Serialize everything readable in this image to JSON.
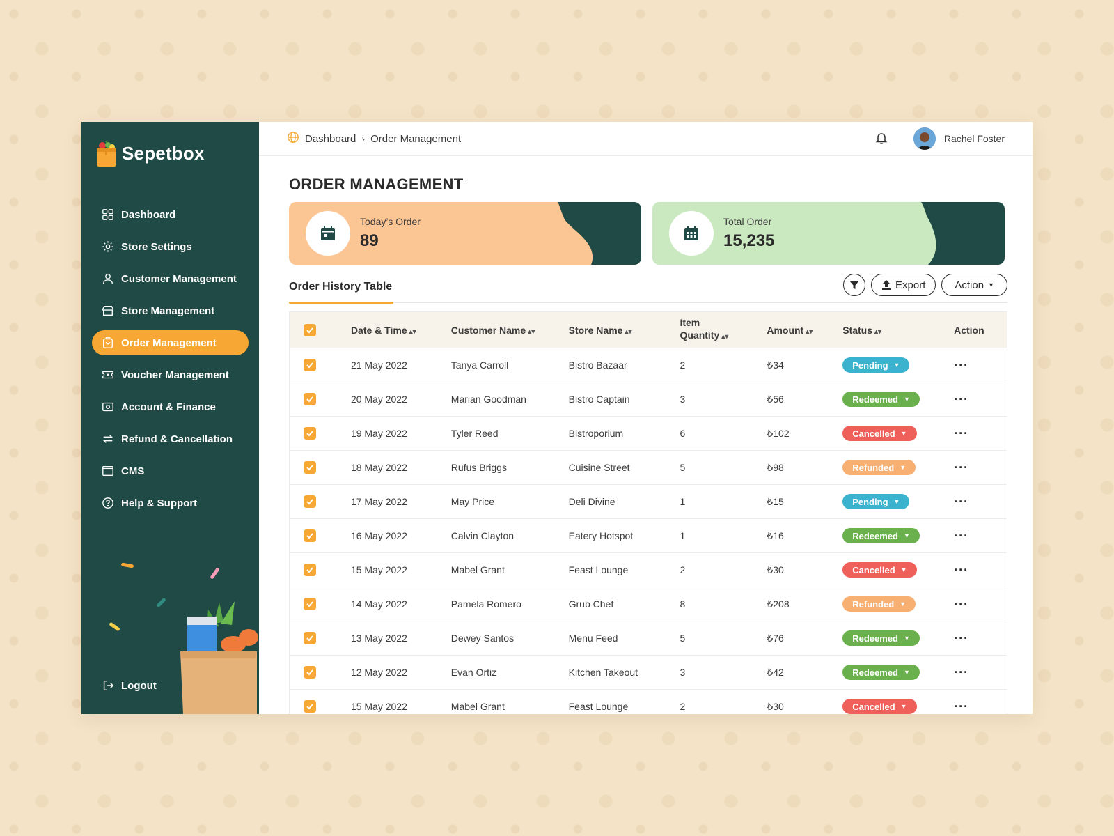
{
  "brand": {
    "name": "Sepetbox"
  },
  "sidebar": {
    "items": [
      {
        "label": "Dashboard",
        "icon": "grid-icon",
        "active": false
      },
      {
        "label": "Store Settings",
        "icon": "gear-icon",
        "active": false
      },
      {
        "label": "Customer Management",
        "icon": "user-icon",
        "active": false
      },
      {
        "label": "Store Management",
        "icon": "store-icon",
        "active": false
      },
      {
        "label": "Order Management",
        "icon": "order-icon",
        "active": true
      },
      {
        "label": "Voucher Management",
        "icon": "voucher-icon",
        "active": false
      },
      {
        "label": "Account & Finance",
        "icon": "wallet-icon",
        "active": false
      },
      {
        "label": "Refund & Cancellation",
        "icon": "refund-icon",
        "active": false
      },
      {
        "label": "CMS",
        "icon": "window-icon",
        "active": false
      },
      {
        "label": "Help & Support",
        "icon": "help-icon",
        "active": false
      }
    ],
    "logout_label": "Logout"
  },
  "header": {
    "breadcrumb": [
      "Dashboard",
      "Order Management"
    ],
    "user_name": "Rachel Foster"
  },
  "page": {
    "title": "ORDER MANAGEMENT"
  },
  "stats": {
    "today": {
      "label": "Today’s Order",
      "value": "89"
    },
    "total": {
      "label": "Total Order",
      "value": "15,235"
    }
  },
  "table": {
    "tab_title": "Order History Table",
    "export_label": "Export",
    "action_label": "Action",
    "columns": {
      "date": "Date & Time",
      "customer": "Customer Name",
      "store": "Store Name",
      "qty_line1": "Item",
      "qty_line2": "Quantity",
      "amount": "Amount",
      "status": "Status",
      "action": "Action"
    },
    "rows": [
      {
        "date": "21 May 2022",
        "customer": "Tanya Carroll",
        "store": "Bistro Bazaar",
        "qty": "2",
        "amount": "₺34",
        "status": "Pending"
      },
      {
        "date": "20 May 2022",
        "customer": "Marian Goodman",
        "store": "Bistro Captain",
        "qty": "3",
        "amount": "₺56",
        "status": "Redeemed"
      },
      {
        "date": "19 May 2022",
        "customer": "Tyler Reed",
        "store": "Bistroporium",
        "qty": "6",
        "amount": "₺102",
        "status": "Cancelled"
      },
      {
        "date": "18 May 2022",
        "customer": "Rufus Briggs",
        "store": "Cuisine Street",
        "qty": "5",
        "amount": "₺98",
        "status": "Refunded"
      },
      {
        "date": "17 May 2022",
        "customer": "May Price",
        "store": "Deli Divine",
        "qty": "1",
        "amount": "₺15",
        "status": "Pending"
      },
      {
        "date": "16 May 2022",
        "customer": "Calvin Clayton",
        "store": "Eatery Hotspot",
        "qty": "1",
        "amount": "₺16",
        "status": "Redeemed"
      },
      {
        "date": "15 May 2022",
        "customer": "Mabel Grant",
        "store": "Feast Lounge",
        "qty": "2",
        "amount": "₺30",
        "status": "Cancelled"
      },
      {
        "date": "14 May 2022",
        "customer": "Pamela Romero",
        "store": "Grub Chef",
        "qty": "8",
        "amount": "₺208",
        "status": "Refunded"
      },
      {
        "date": "13 May 2022",
        "customer": "Dewey Santos",
        "store": "Menu Feed",
        "qty": "5",
        "amount": "₺76",
        "status": "Redeemed"
      },
      {
        "date": "12 May 2022",
        "customer": "Evan Ortiz",
        "store": "Kitchen Takeout",
        "qty": "3",
        "amount": "₺42",
        "status": "Redeemed"
      },
      {
        "date": "15 May 2022",
        "customer": "Mabel Grant",
        "store": "Feast Lounge",
        "qty": "2",
        "amount": "₺30",
        "status": "Cancelled"
      }
    ]
  },
  "colors": {
    "sidebar": "#1f4a45",
    "accent": "#f7a733",
    "pending": "#3bb3cf",
    "redeemed": "#6ab04c",
    "cancelled": "#f0605a",
    "refunded": "#f7b072"
  }
}
